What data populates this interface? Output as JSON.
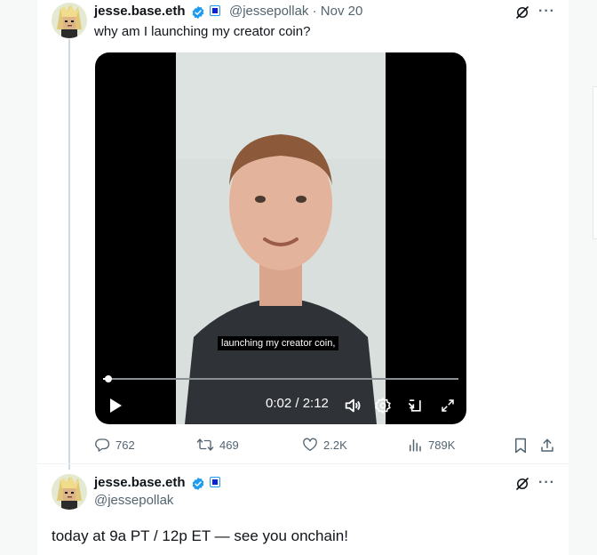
{
  "tweet1": {
    "author_name": "jesse.base.eth",
    "handle": "@jessepollak",
    "separator": "·",
    "date": "Nov 20",
    "text": "why am I launching my creator coin?",
    "video": {
      "caption": "launching my creator coin,",
      "time_display": "0:02 / 2:12",
      "progress_fraction": 0.016
    },
    "actions": {
      "replies": "762",
      "reposts": "469",
      "likes": "2.2K",
      "views": "789K"
    }
  },
  "tweet2": {
    "author_name": "jesse.base.eth",
    "handle": "@jessepollak",
    "text": "today at 9a PT / 12p ET — see you onchain!"
  },
  "icons": {
    "verified": "verified-badge-icon",
    "affiliate": "affiliate-square-icon",
    "grok": "grok-slash-icon",
    "more": "more-icon",
    "more_glyph": "···"
  },
  "colors": {
    "accent": "#1d9bf0",
    "text": "#0f1419",
    "muted": "#536471"
  }
}
